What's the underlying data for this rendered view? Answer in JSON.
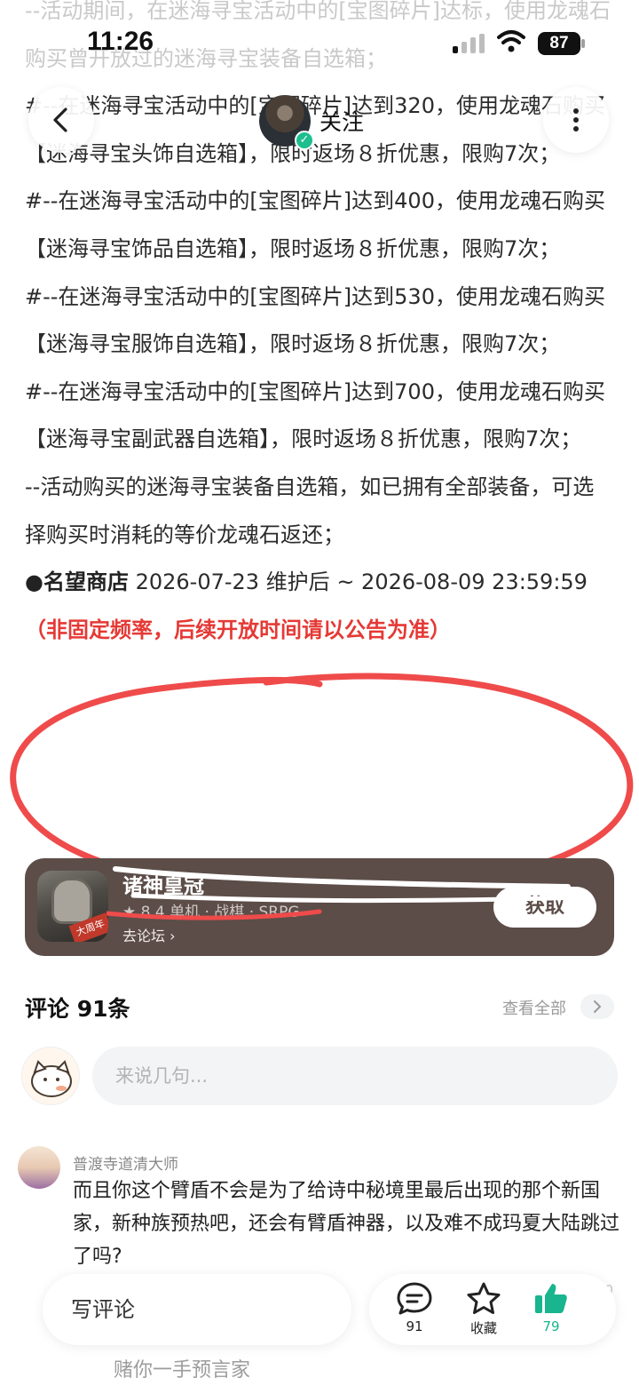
{
  "status_bar": {
    "time": "11:26",
    "battery": "87"
  },
  "nav": {
    "follow_label": "关注"
  },
  "article": {
    "lines": [
      {
        "text": "--活动期间，在迷海寻宝活动中的[宝图碎片]达标，使用龙魂石购买曾开放过的迷海寻宝装备自选箱；",
        "faded": true
      },
      {
        "text": "#--在迷海寻宝活动中的[宝图碎片]达到320，使用龙魂石购买【迷海寻宝头饰自选箱】，限时返场８折优惠，限购7次；",
        "faded": false
      },
      {
        "text": "#--在迷海寻宝活动中的[宝图碎片]达到400，使用龙魂石购买【迷海寻宝饰品自选箱】，限时返场８折优惠，限购7次；",
        "faded": false
      },
      {
        "text": "#--在迷海寻宝活动中的[宝图碎片]达到530，使用龙魂石购买【迷海寻宝服饰自选箱】，限时返场８折优惠，限购7次；",
        "faded": false
      },
      {
        "text": "#--在迷海寻宝活动中的[宝图碎片]达到700，使用龙魂石购买【迷海寻宝副武器自选箱】，限时返场８折优惠，限购7次；",
        "faded": false
      },
      {
        "text": "--活动购买的迷海寻宝装备自选箱，如已拥有全部装备，可选择购买时消耗的等价龙魂石返还；",
        "faded": false
      }
    ],
    "shop_title": "●名望商店",
    "shop_dates": " 2026-07-23 维护后 ~ 2026-08-09 23:59:59",
    "shop_note": "（非固定频率，后续开放时间请以公告为准）"
  },
  "game_card": {
    "name": "诸神皇冠",
    "meta": "★ 8.4  单机 · 战棋 · SRPG",
    "forum_link": "去论坛",
    "stamp": "大周年",
    "get_button": "获取"
  },
  "comments": {
    "title": "评论 91条",
    "view_all": "查看全部",
    "input_placeholder": "来说几句...",
    "items": [
      {
        "user": "普渡寺道清大师",
        "text": "而且你这个臂盾不会是为了给诗中秘境里最后出现的那个新国家，新种族预热吧，还会有臂盾神器，以及难不成玛夏大陆跳过了吗?"
      }
    ],
    "faint_count": "10",
    "reply_preview": "赌你一手预言家"
  },
  "bottom_bar": {
    "write_comment": "写评论",
    "comment_count": "91",
    "collect_label": "收藏",
    "like_count": "79"
  },
  "colors": {
    "accent_green": "#18b58e",
    "highlight_red": "#e53935",
    "card_brown": "#5c4d48"
  }
}
